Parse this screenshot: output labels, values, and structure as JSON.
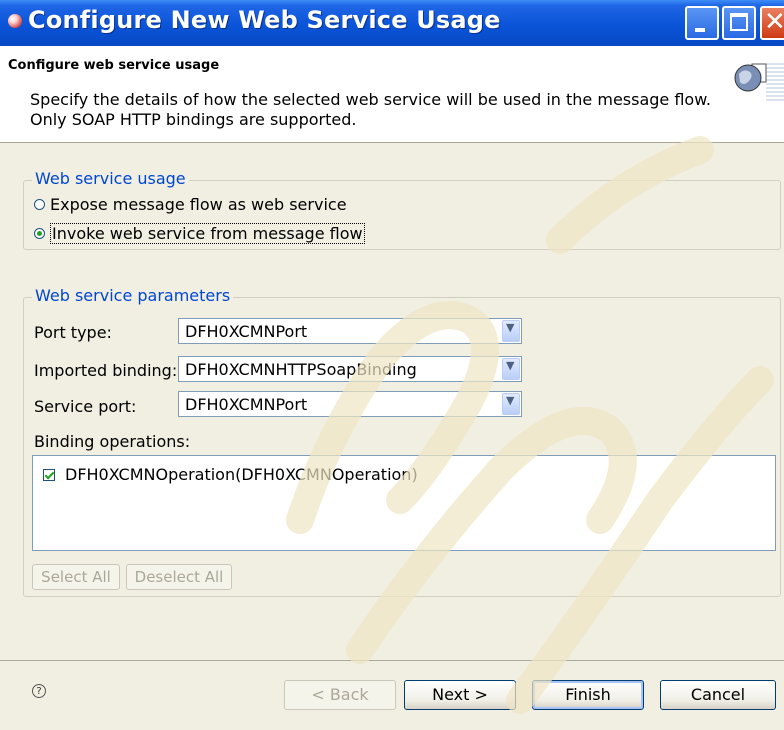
{
  "window": {
    "title": "Configure New Web Service Usage"
  },
  "header": {
    "title": "Configure web service usage",
    "description_lines": [
      "Specify the details of how the selected web service will be used in the message flow.",
      "Only SOAP HTTP bindings are supported."
    ]
  },
  "usage": {
    "legend": "Web service usage",
    "options": [
      {
        "label": "Expose message flow as web service",
        "selected": false
      },
      {
        "label": "Invoke web service from message flow",
        "selected": true
      }
    ]
  },
  "params": {
    "legend": "Web service parameters",
    "port_type": {
      "label": "Port type:",
      "value": "DFH0XCMNPort"
    },
    "imported_binding": {
      "label": "Imported binding:",
      "value": "DFH0XCMNHTTPSoapBinding"
    },
    "service_port": {
      "label": "Service port:",
      "value": "DFH0XCMNPort"
    },
    "operations_label": "Binding operations:",
    "operations": [
      {
        "label": "DFH0XCMNOperation(DFH0XCMNOperation)",
        "checked": true
      }
    ],
    "select_all": "Select All",
    "deselect_all": "Deselect All"
  },
  "footer": {
    "help": "?",
    "back": "< Back",
    "next": "Next >",
    "finish": "Finish",
    "cancel": "Cancel"
  },
  "colors": {
    "title_bar": "#0a54d8",
    "dialog_bg": "#f1efe2",
    "legend_text": "#0046d5"
  }
}
